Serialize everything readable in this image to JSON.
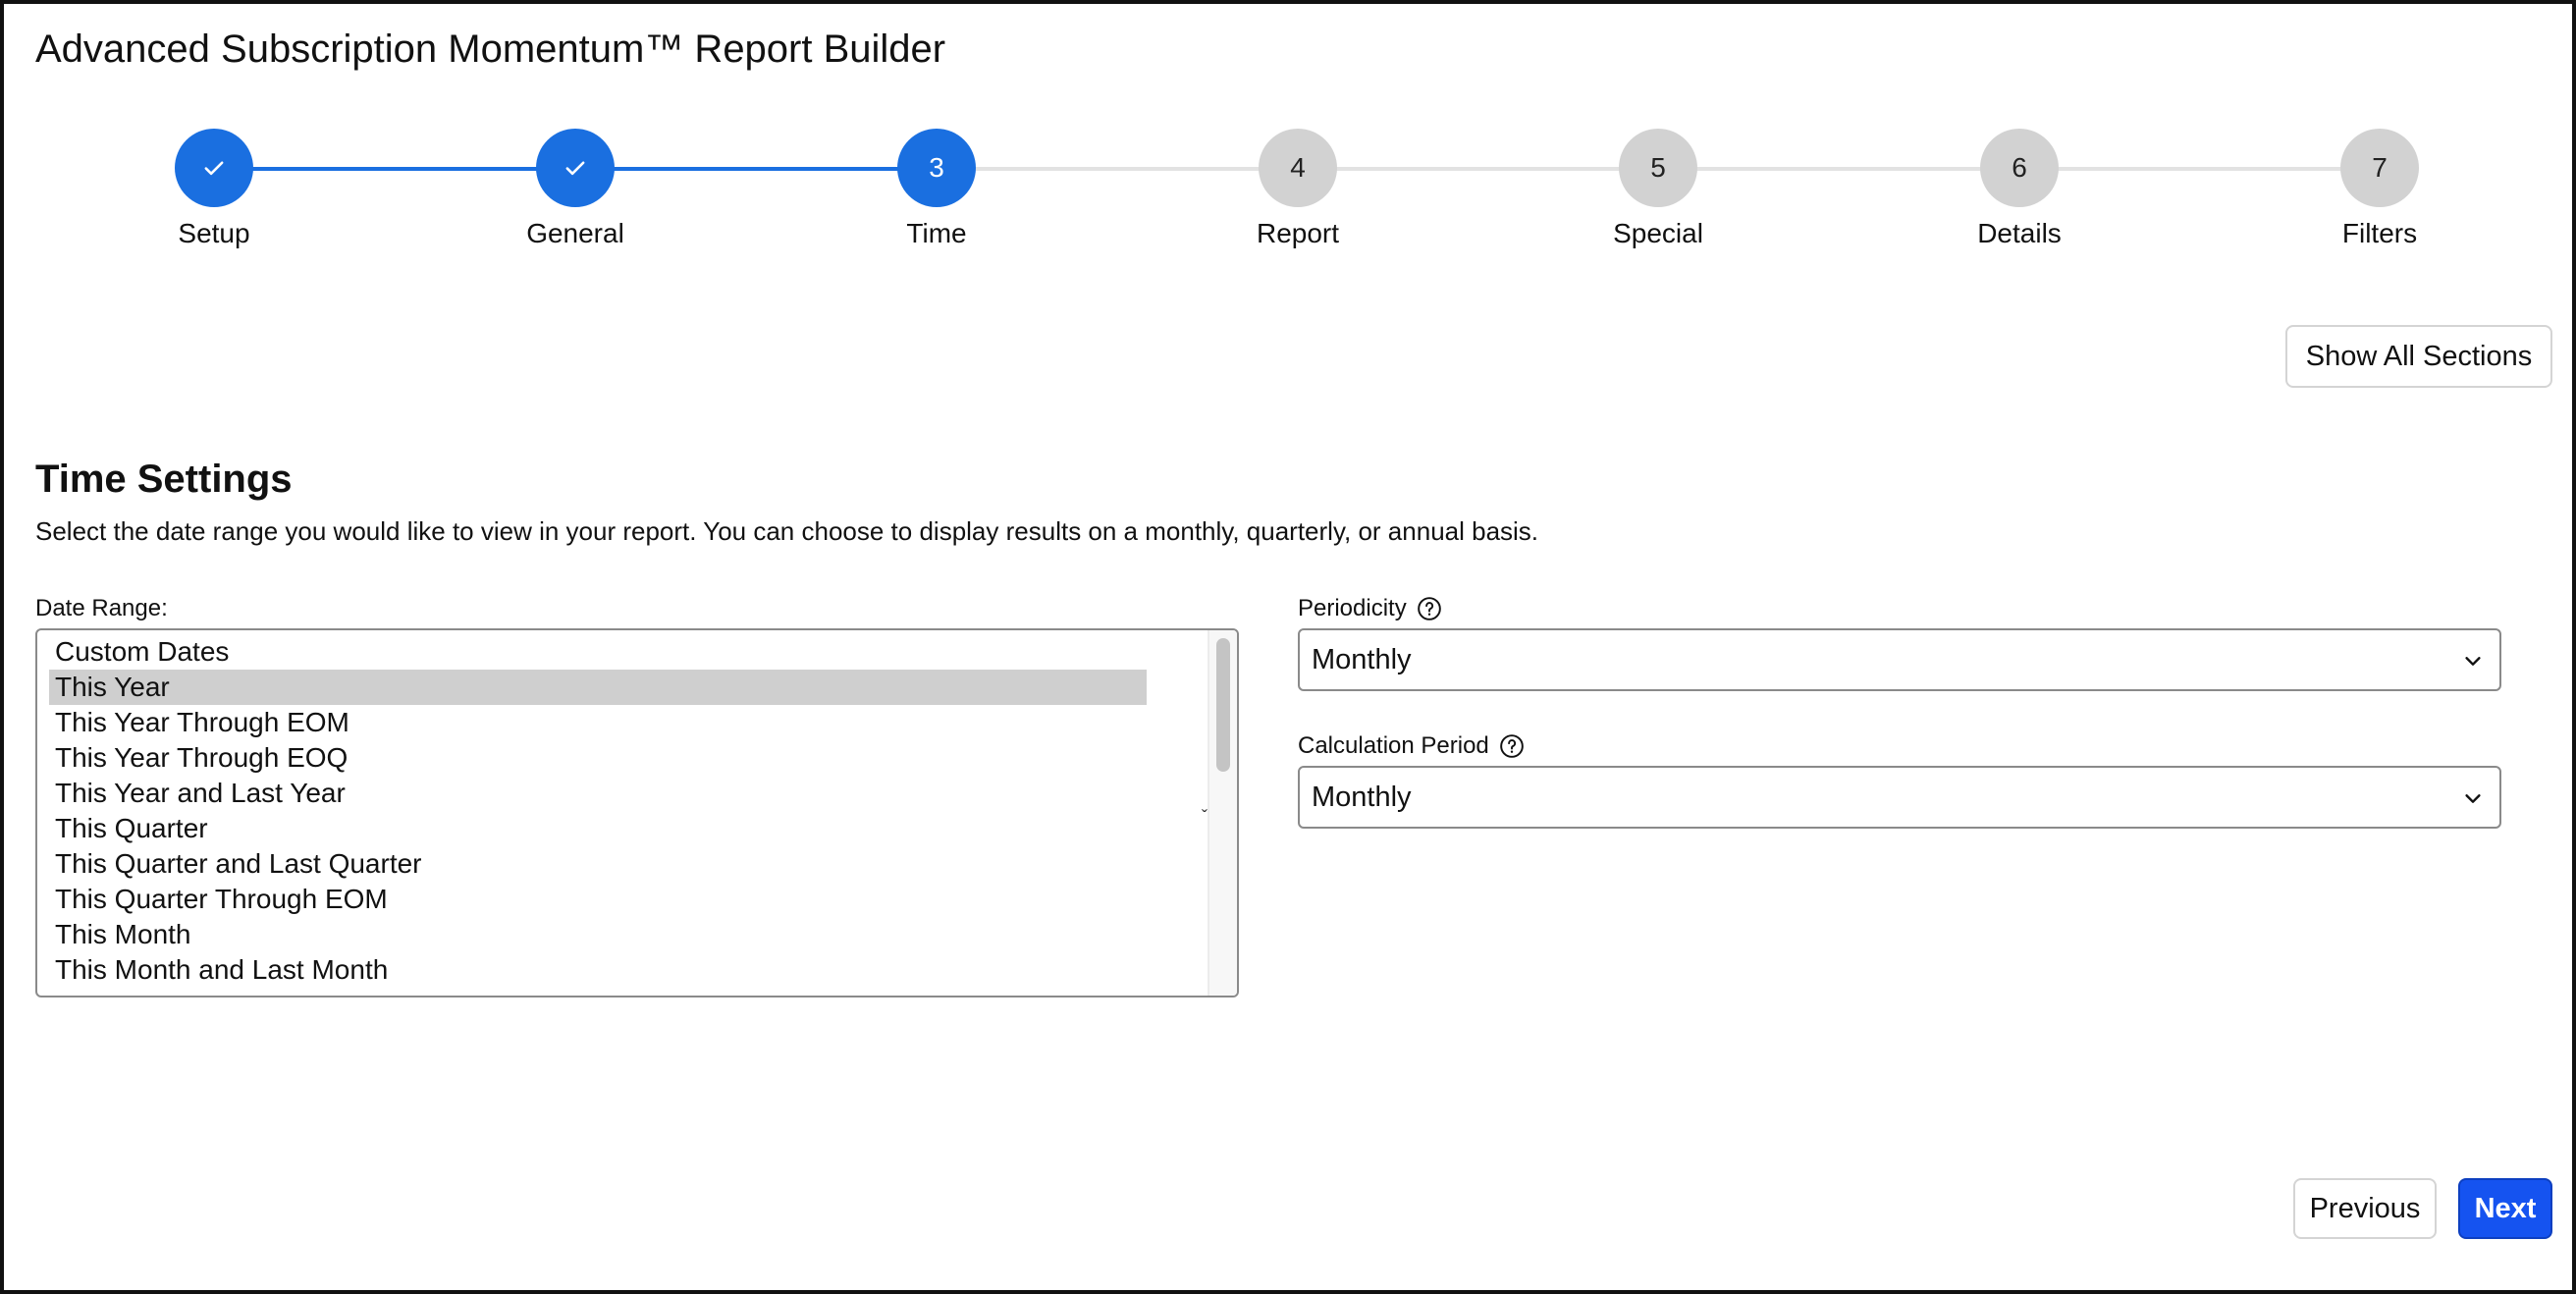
{
  "app": {
    "title": "Advanced Subscription Momentum™ Report Builder"
  },
  "colors": {
    "accent": "#1a6fe0",
    "primary_button": "#1553f0",
    "pending_step": "#d2d2d2",
    "selected_item": "#cfcfcf"
  },
  "stepper": {
    "steps": [
      {
        "number": "1",
        "label": "Setup",
        "state": "done",
        "icon": "check-icon"
      },
      {
        "number": "2",
        "label": "General",
        "state": "done",
        "icon": "check-icon"
      },
      {
        "number": "3",
        "label": "Time",
        "state": "current"
      },
      {
        "number": "4",
        "label": "Report",
        "state": "todo"
      },
      {
        "number": "5",
        "label": "Special",
        "state": "todo"
      },
      {
        "number": "6",
        "label": "Details",
        "state": "todo"
      },
      {
        "number": "7",
        "label": "Filters",
        "state": "todo"
      }
    ]
  },
  "toolbar": {
    "show_all_label": "Show All Sections"
  },
  "section": {
    "title": "Time Settings",
    "description": "Select the date range you would like to view in your report. You can choose to display results on a monthly, quarterly, or annual basis."
  },
  "date_range": {
    "label": "Date Range:",
    "selected": "This Year",
    "options": [
      "Custom Dates",
      "This Year",
      "This Year Through EOM",
      "This Year Through EOQ",
      "This Year and Last Year",
      "This Quarter",
      "This Quarter and Last Quarter",
      "This Quarter Through EOM",
      "This Month",
      "This Month and Last Month"
    ]
  },
  "periodicity": {
    "label": "Periodicity",
    "value": "Monthly",
    "help_icon": "question-circle-icon"
  },
  "calculation_period": {
    "label": "Calculation Period",
    "value": "Monthly",
    "help_icon": "question-circle-icon"
  },
  "footer": {
    "previous_label": "Previous",
    "next_label": "Next"
  }
}
